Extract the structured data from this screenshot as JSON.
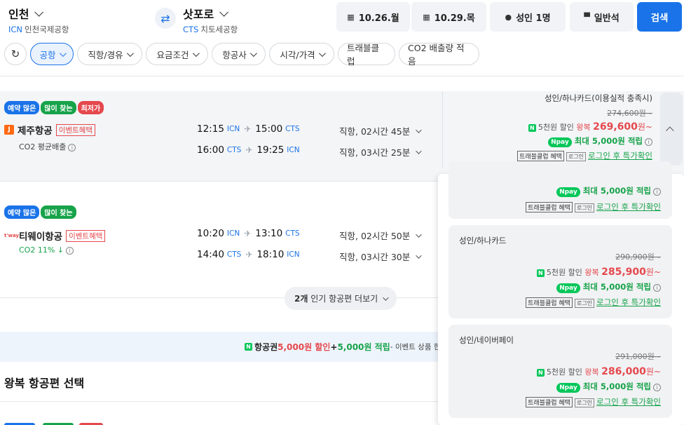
{
  "header": {
    "origin": {
      "city": "인천",
      "code": "ICN",
      "airport": "인천국제공항"
    },
    "destination": {
      "city": "삿포로",
      "code": "CTS",
      "airport": "치토세공항"
    },
    "depart_date": "10.26.월",
    "return_date": "10.29.목",
    "passengers": "성인 1명",
    "cabin": "일반석",
    "search_label": "검색"
  },
  "filters": [
    "공항",
    "직항/경유",
    "요금조건",
    "항공사",
    "시각/가격",
    "트래블클럽",
    "CO2 배출량 적음"
  ],
  "results": [
    {
      "badges": [
        "예약 많은",
        "많이 찾는",
        "최저가"
      ],
      "airline": "제주항공",
      "logo": "J",
      "event": "이벤트혜택",
      "co2": "CO2 평균배출",
      "outbound": {
        "dep": "12:15",
        "dep_ap": "ICN",
        "arr": "15:00",
        "arr_ap": "CTS",
        "dur": "직항, 02시간 45분"
      },
      "inbound": {
        "dep": "16:00",
        "dep_ap": "CTS",
        "arr": "19:25",
        "arr_ap": "ICN",
        "dur": "직항, 03시간 25분"
      },
      "price": {
        "label": "성인/하나카드(이용실적 충족시)",
        "original": "274,600원~",
        "discount": "5천원 할인",
        "round_trip": "왕복",
        "final": "269,600",
        "suffix": "원~",
        "earn": "최대 5,000원 적립",
        "travel_club": "트래블클럽 혜택",
        "login": "로그인 후 특가확인"
      }
    },
    {
      "badges": [
        "예약 많은",
        "많이 찾는"
      ],
      "airline": "티웨이항공",
      "logo": "t'way",
      "event": "이벤트혜택",
      "co2": "CO2 11% ↓",
      "outbound": {
        "dep": "10:20",
        "dep_ap": "ICN",
        "arr": "13:10",
        "arr_ap": "CTS",
        "dur": "직항, 02시간 50분"
      },
      "inbound": {
        "dep": "14:40",
        "dep_ap": "CTS",
        "arr": "18:10",
        "arr_ap": "ICN",
        "dur": "직항, 03시간 30분"
      }
    }
  ],
  "more_button": {
    "count": "2개",
    "text": " 인기 항공편 더보기"
  },
  "promo": {
    "n": "N",
    "a": "항공권 ",
    "b": "5,000원 할인",
    "c": " + ",
    "d": "5,000원 적립",
    "e": " - 이벤트 상품 한정"
  },
  "section_title": "왕복 항공편 선택",
  "dropdown_cards": [
    {
      "label": "",
      "earn": "최대 5,000원 적립",
      "travel_club": "트래블클럽 혜택",
      "login": "로그인 후 특가확인"
    },
    {
      "label": "성인/하나카드",
      "original": "290,900원~",
      "discount": "5천원 할인",
      "round_trip": "왕복",
      "final": "285,900",
      "suffix": "원~",
      "earn": "최대 5,000원 적립",
      "travel_club": "트래블클럽 혜택",
      "login": "로그인 후 특가확인"
    },
    {
      "label": "성인/네이버페이",
      "original": "291,000원~",
      "discount": "5천원 할인",
      "round_trip": "왕복",
      "final": "286,000",
      "suffix": "원~",
      "earn": "최대 5,000원 적립",
      "travel_club": "트래블클럽 혜택",
      "login": "로그인 후 특가확인"
    }
  ],
  "labels": {
    "npay": "Npay",
    "login_tag": "로그인",
    "info": "i",
    "calendar_icon": "▦",
    "person_icon": "●",
    "seat_icon": "▀",
    "swap_icon": "⇄",
    "refresh_icon": "↻",
    "plane_icon": "✈",
    "n_icon": "N"
  }
}
